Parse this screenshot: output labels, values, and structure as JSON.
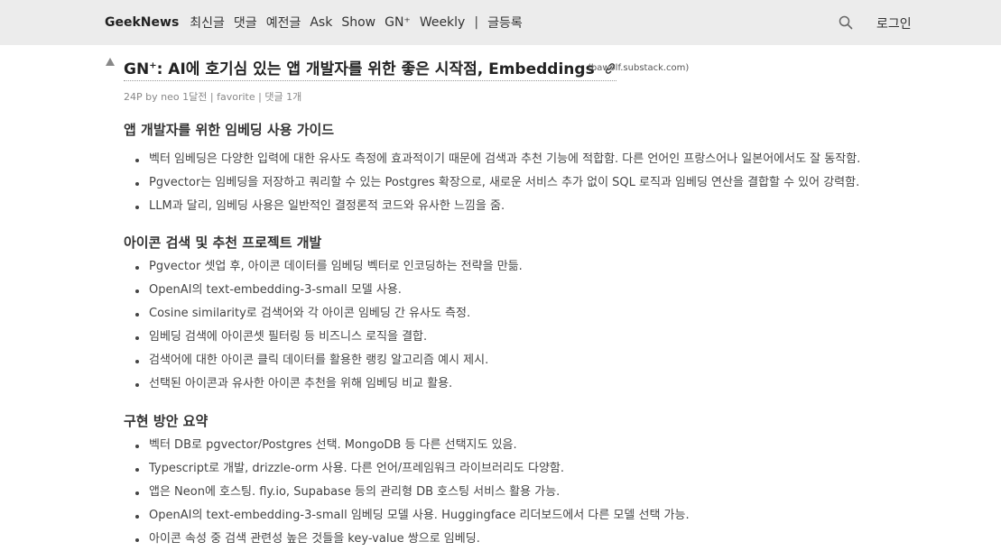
{
  "nav": {
    "brand": "GeekNews",
    "items": [
      "최신글",
      "댓글",
      "예전글",
      "Ask",
      "Show",
      "GN⁺",
      "Weekly"
    ],
    "separator": "|",
    "submit": "글등록",
    "login": "로그인",
    "search_icon": "search-icon"
  },
  "post": {
    "title_prefix": "GN",
    "title_sup": "+",
    "title_main": ": AI에 호기심 있는 앱 개발자를 위한 좋은 시작점, Embeddings",
    "domain": "(bawolf.substack.com)",
    "meta": {
      "points": "24P",
      "by": "by",
      "author": "neo",
      "time": "1달전",
      "sep": "|",
      "favorite": "favorite",
      "comments": "댓글 1개"
    }
  },
  "sections": [
    {
      "heading": "앱 개발자를 위한 임베딩 사용 가이드",
      "items": [
        "벡터 임베딩은 다양한 입력에 대한 유사도 측정에 효과적이기 때문에 검색과 추천 기능에 적합함. 다른 언어인 프랑스어나 일본어에서도 잘 동작함.",
        "Pgvector는 임베딩을 저장하고 쿼리할 수 있는 Postgres 확장으로, 새로운 서비스 추가 없이 SQL 로직과 임베딩 연산을 결합할 수 있어 강력함.",
        "LLM과 달리, 임베딩 사용은 일반적인 결정론적 코드와 유사한 느낌을 줌."
      ]
    },
    {
      "heading": "아이콘 검색 및 추천 프로젝트 개발",
      "items": [
        "Pgvector 셋업 후, 아이콘 데이터를 임베딩 벡터로 인코딩하는 전략을 만듦.",
        "OpenAI의 text-embedding-3-small 모델 사용.",
        "Cosine similarity로 검색어와 각 아이콘 임베딩 간 유사도 측정.",
        "임베딩 검색에 아이콘셋 필터링 등 비즈니스 로직을 결합.",
        "검색어에 대한 아이콘 클릭 데이터를 활용한 랭킹 알고리즘 예시 제시.",
        "선택된 아이콘과 유사한 아이콘 추천을 위해 임베딩 비교 활용."
      ]
    },
    {
      "heading": "구현 방안 요약",
      "items": [
        "벡터 DB로 pgvector/Postgres 선택. MongoDB 등 다른 선택지도 있음.",
        "Typescript로 개발, drizzle-orm 사용. 다른 언어/프레임워크 라이브러리도 다양함.",
        "앱은 Neon에 호스팅. fly.io, Supabase 등의 관리형 DB 호스팅 서비스 활용 가능.",
        "OpenAI의 text-embedding-3-small 임베딩 모델 사용. Huggingface 리더보드에서 다른 모델 선택 가능.",
        "아이콘 속성 중 검색 관련성 높은 것들을 key-value 쌍으로 임베딩."
      ]
    }
  ]
}
